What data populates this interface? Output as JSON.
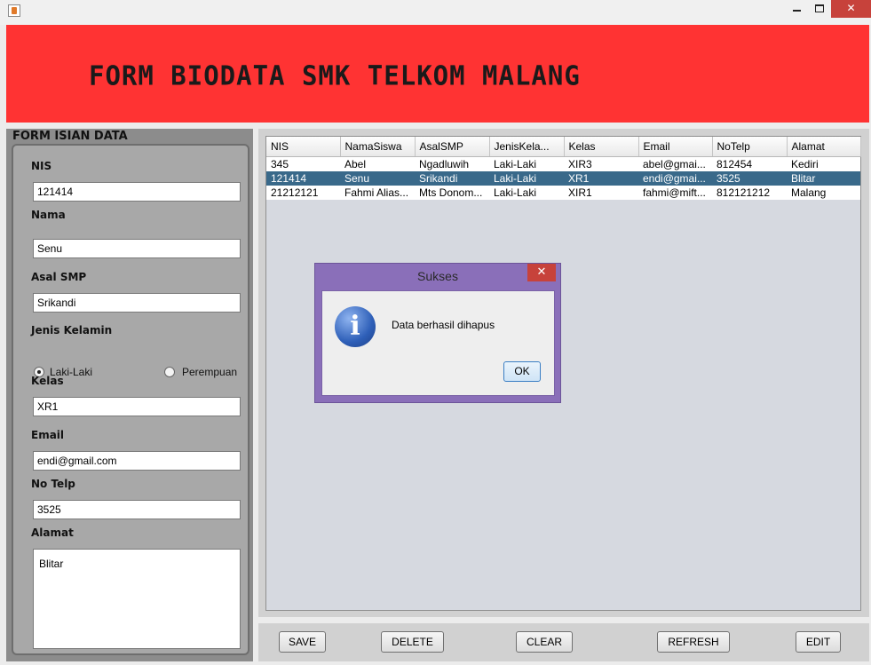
{
  "window": {
    "close_glyph": "✕"
  },
  "header": {
    "title": "FORM BIODATA SMK TELKOM MALANG"
  },
  "form": {
    "title": "FORM ISIAN DATA",
    "nis": {
      "label": "NIS",
      "value": "121414"
    },
    "nama": {
      "label": "Nama",
      "value": "Senu"
    },
    "asal_smp": {
      "label": "Asal SMP",
      "value": "Srikandi"
    },
    "jenis_kelamin": {
      "label": "Jenis Kelamin",
      "options": [
        "Laki-Laki",
        "Perempuan"
      ],
      "selected": "Laki-Laki"
    },
    "kelas": {
      "label": "Kelas",
      "value": "XR1"
    },
    "email": {
      "label": "Email",
      "value": "endi@gmail.com"
    },
    "no_telp": {
      "label": "No Telp",
      "value": "3525"
    },
    "alamat": {
      "label": "Alamat",
      "value": "Blitar"
    }
  },
  "table": {
    "columns": [
      "NIS",
      "NamaSiswa",
      "AsalSMP",
      "JenisKela...",
      "Kelas",
      "Email",
      "NoTelp",
      "Alamat"
    ],
    "rows": [
      [
        "345",
        "Abel",
        "Ngadluwih",
        "Laki-Laki",
        "XIR3",
        "abel@gmai...",
        "812454",
        "Kediri"
      ],
      [
        "121414",
        "Senu",
        "Srikandi",
        "Laki-Laki",
        "XR1",
        "endi@gmai...",
        "3525",
        "Blitar"
      ],
      [
        "21212121",
        "Fahmi Alias...",
        "Mts Donom...",
        "Laki-Laki",
        "XIR1",
        "fahmi@mift...",
        "812121212",
        "Malang"
      ]
    ],
    "selected_row": 1
  },
  "dialog": {
    "title": "Sukses",
    "close_glyph": "✕",
    "icon": "info-icon",
    "icon_glyph": "i",
    "message": "Data berhasil dihapus",
    "ok_label": "OK"
  },
  "buttons": {
    "save": "SAVE",
    "delete": "DELETE",
    "clear": "CLEAR",
    "refresh": "REFRESH",
    "edit": "EDIT"
  },
  "colors": {
    "header_bg": "#ff3333",
    "selection": "#39698a",
    "dialog_frame": "#8a6fb9",
    "close_red": "#c7423b"
  }
}
